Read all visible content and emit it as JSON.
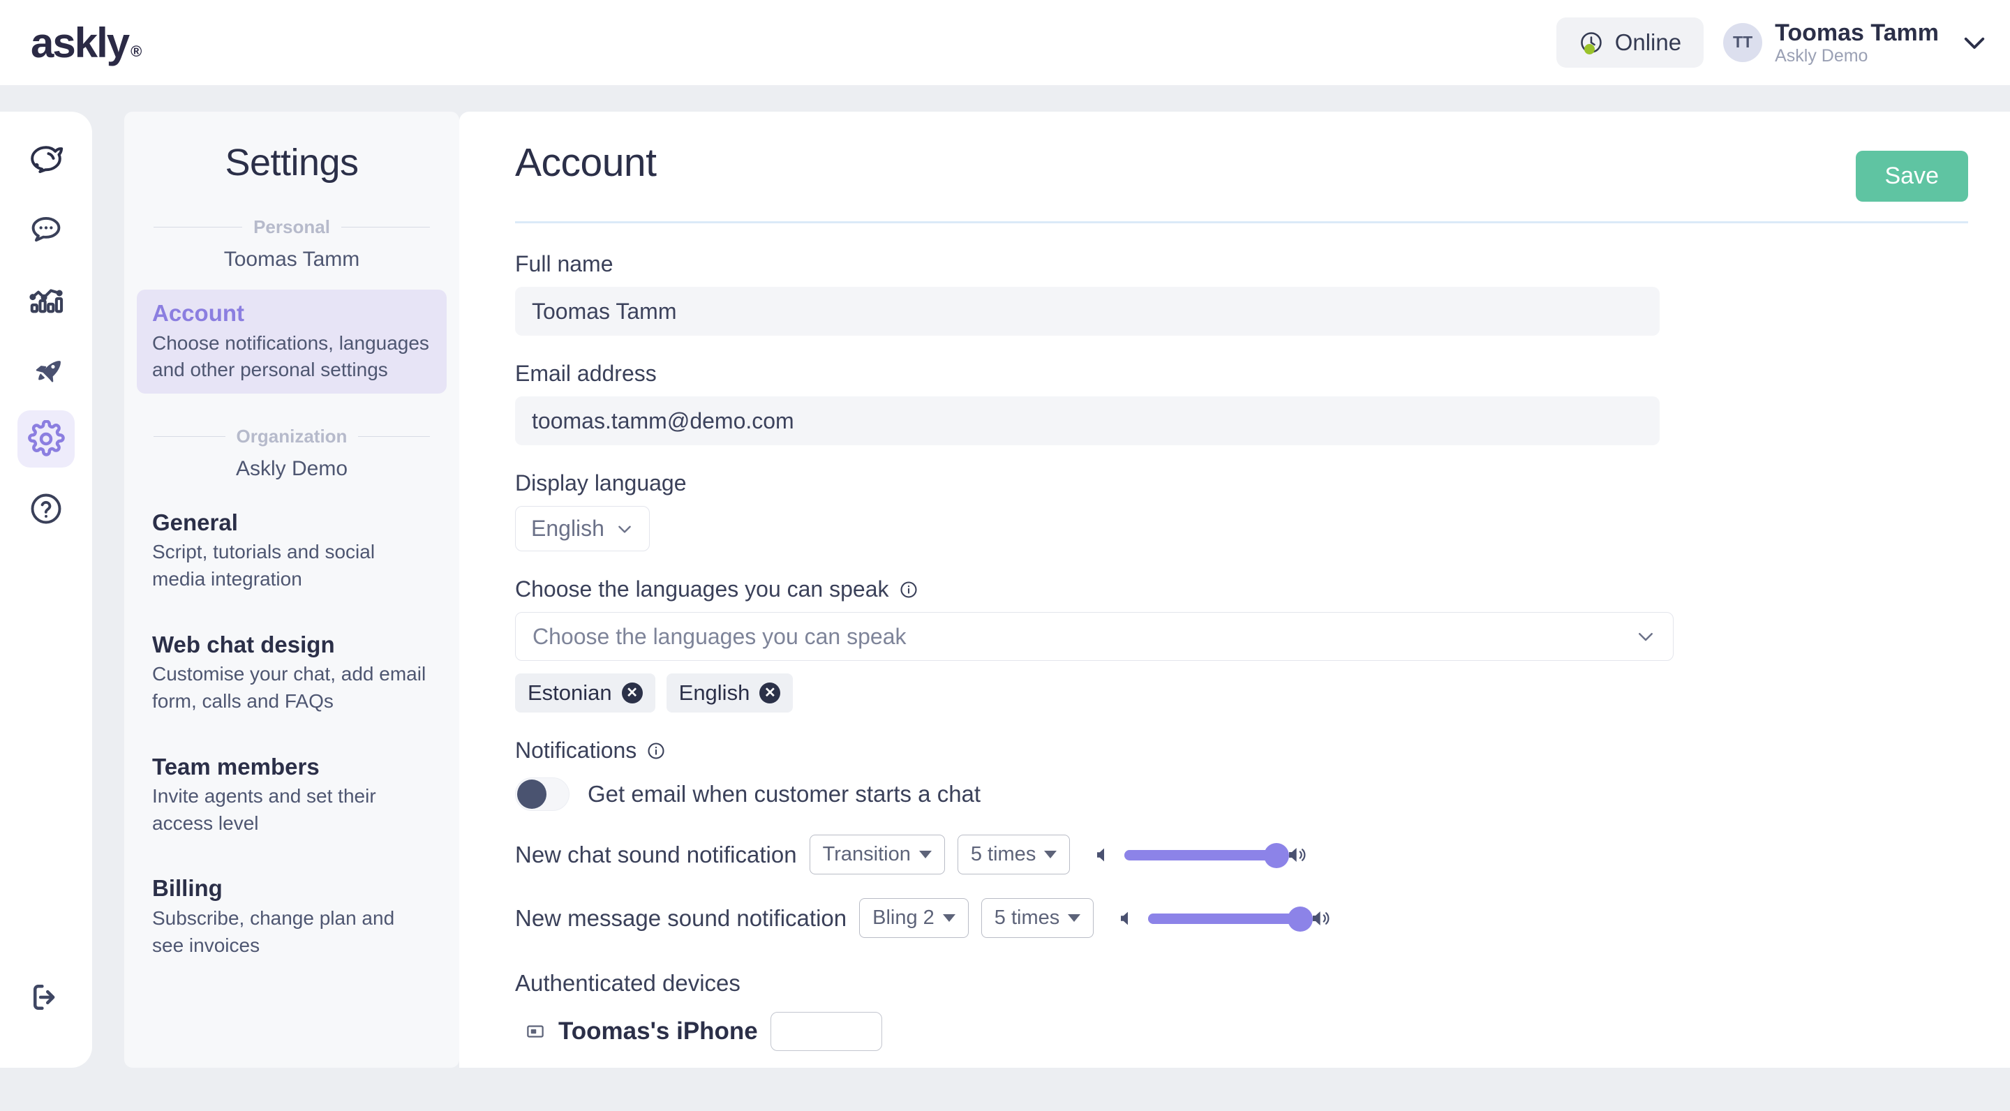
{
  "brand": {
    "logo_text": "askly",
    "logo_mark": "registered-trademark",
    "accent_purple": "#8b7ee0",
    "accent_green": "#5fc4a2",
    "status_dot_green": "#9ac22b",
    "dark_navy": "#2b2f48"
  },
  "topbar": {
    "status": {
      "label": "Online",
      "icon": "clock-icon"
    },
    "user": {
      "initials": "TT",
      "name": "Toomas Tamm",
      "organization": "Askly Demo"
    },
    "chevron_icon": "chevron-down-icon"
  },
  "rail": {
    "items": [
      {
        "icon": "lemon-logo-icon",
        "active": false
      },
      {
        "icon": "chat-bubble-icon",
        "active": false
      },
      {
        "icon": "analytics-chart-icon",
        "active": false
      },
      {
        "icon": "rocket-icon",
        "active": false
      },
      {
        "icon": "gear-icon",
        "active": true
      },
      {
        "icon": "question-circle-icon",
        "active": false
      }
    ],
    "logout_icon": "logout-icon"
  },
  "sidebar": {
    "title": "Settings",
    "groups": [
      {
        "group_label": "Personal",
        "group_sub": "Toomas Tamm",
        "items": [
          {
            "title": "Account",
            "description": "Choose notifications, languages and other personal settings",
            "active": true
          }
        ]
      },
      {
        "group_label": "Organization",
        "group_sub": "Askly Demo",
        "items": [
          {
            "title": "General",
            "description": "Script, tutorials and social media integration",
            "active": false
          },
          {
            "title": "Web chat design",
            "description": "Customise your chat, add email form, calls and FAQs",
            "active": false
          },
          {
            "title": "Team members",
            "description": "Invite agents and set their access level",
            "active": false
          },
          {
            "title": "Billing",
            "description": "Subscribe, change plan and see invoices",
            "active": false
          }
        ]
      }
    ]
  },
  "main": {
    "page_title": "Account",
    "save_label": "Save",
    "full_name": {
      "label": "Full name",
      "value": "Toomas Tamm"
    },
    "email": {
      "label": "Email address",
      "value": "toomas.tamm@demo.com"
    },
    "display_language": {
      "label": "Display language",
      "value": "English"
    },
    "spoken_languages": {
      "label": "Choose the languages you can speak",
      "info_icon": "info-circle-icon",
      "placeholder": "Choose the languages you can speak",
      "chevron_icon": "chevron-down-icon",
      "chips": [
        "Estonian",
        "English"
      ],
      "chip_remove_icon": "close-circle-icon"
    },
    "notifications": {
      "label": "Notifications",
      "info_icon": "info-circle-icon",
      "email_toggle": {
        "label": "Get email when customer starts a chat",
        "on": false
      },
      "sound_rows": [
        {
          "label": "New chat sound notification",
          "sound": "Transition",
          "repeat": "5 times",
          "volume_percent": 100,
          "mute_icon": "speaker-mute-icon",
          "volume_icon": "speaker-volume-icon"
        },
        {
          "label": "New message sound notification",
          "sound": "Bling 2",
          "repeat": "5 times",
          "volume_percent": 100,
          "mute_icon": "speaker-mute-icon",
          "volume_icon": "speaker-volume-icon"
        }
      ]
    },
    "devices": {
      "label": "Authenticated devices",
      "rows": [
        {
          "name": "Toomas's iPhone",
          "icon": "device-icon"
        }
      ]
    }
  }
}
